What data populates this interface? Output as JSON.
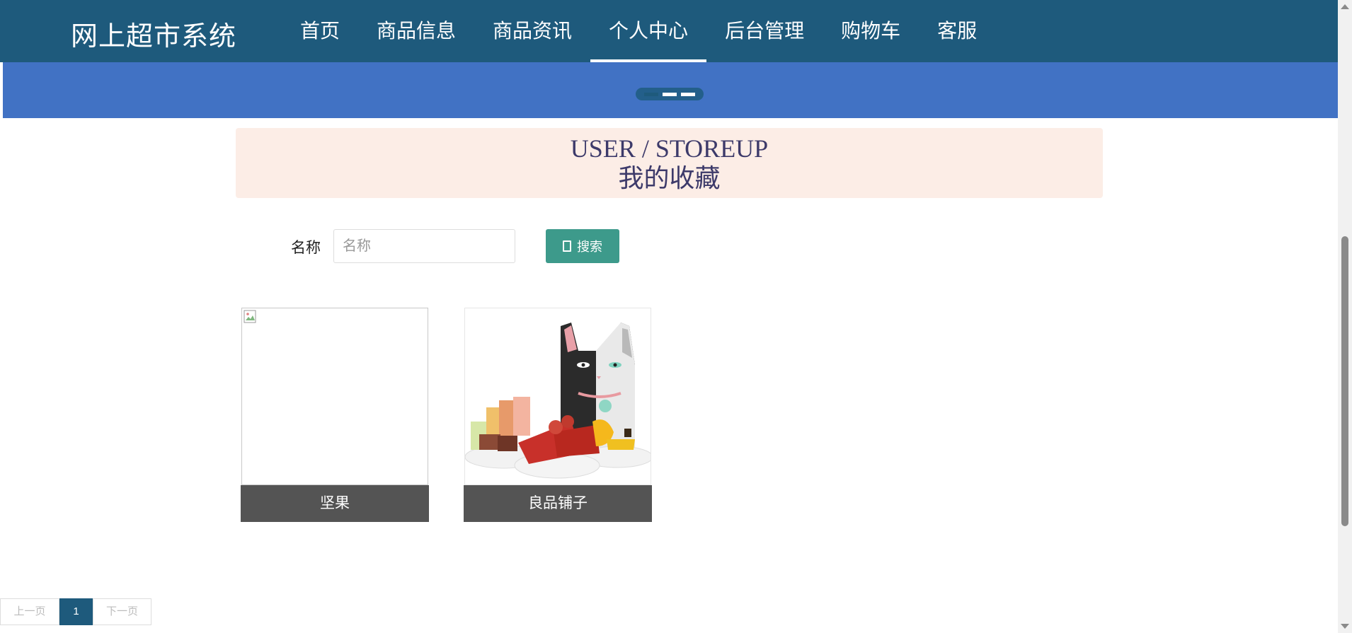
{
  "app": {
    "title": "网上超市系统"
  },
  "nav": {
    "items": [
      {
        "label": "首页"
      },
      {
        "label": "商品信息"
      },
      {
        "label": "商品资讯"
      },
      {
        "label": "个人中心",
        "active": true
      },
      {
        "label": "后台管理"
      },
      {
        "label": "购物车"
      },
      {
        "label": "客服"
      }
    ]
  },
  "carousel": {
    "slides": 3,
    "active_index": 0
  },
  "page_header": {
    "en": "USER / STOREUP",
    "cn": "我的收藏"
  },
  "search": {
    "label": "名称",
    "placeholder": "名称",
    "value": "",
    "button_label": "搜索"
  },
  "favorites": [
    {
      "name": "坚果",
      "image": "broken-image-icon"
    },
    {
      "name": "良品铺子",
      "image": "snack-cat-bag-image"
    }
  ],
  "pagination": {
    "prev": "上一页",
    "current": "1",
    "next": "下一页"
  },
  "colors": {
    "nav": "#1e5a7c",
    "banner": "#4172c4",
    "header_bg": "#fcede6",
    "search_button": "#3d9a8b",
    "caption": "#545454"
  }
}
